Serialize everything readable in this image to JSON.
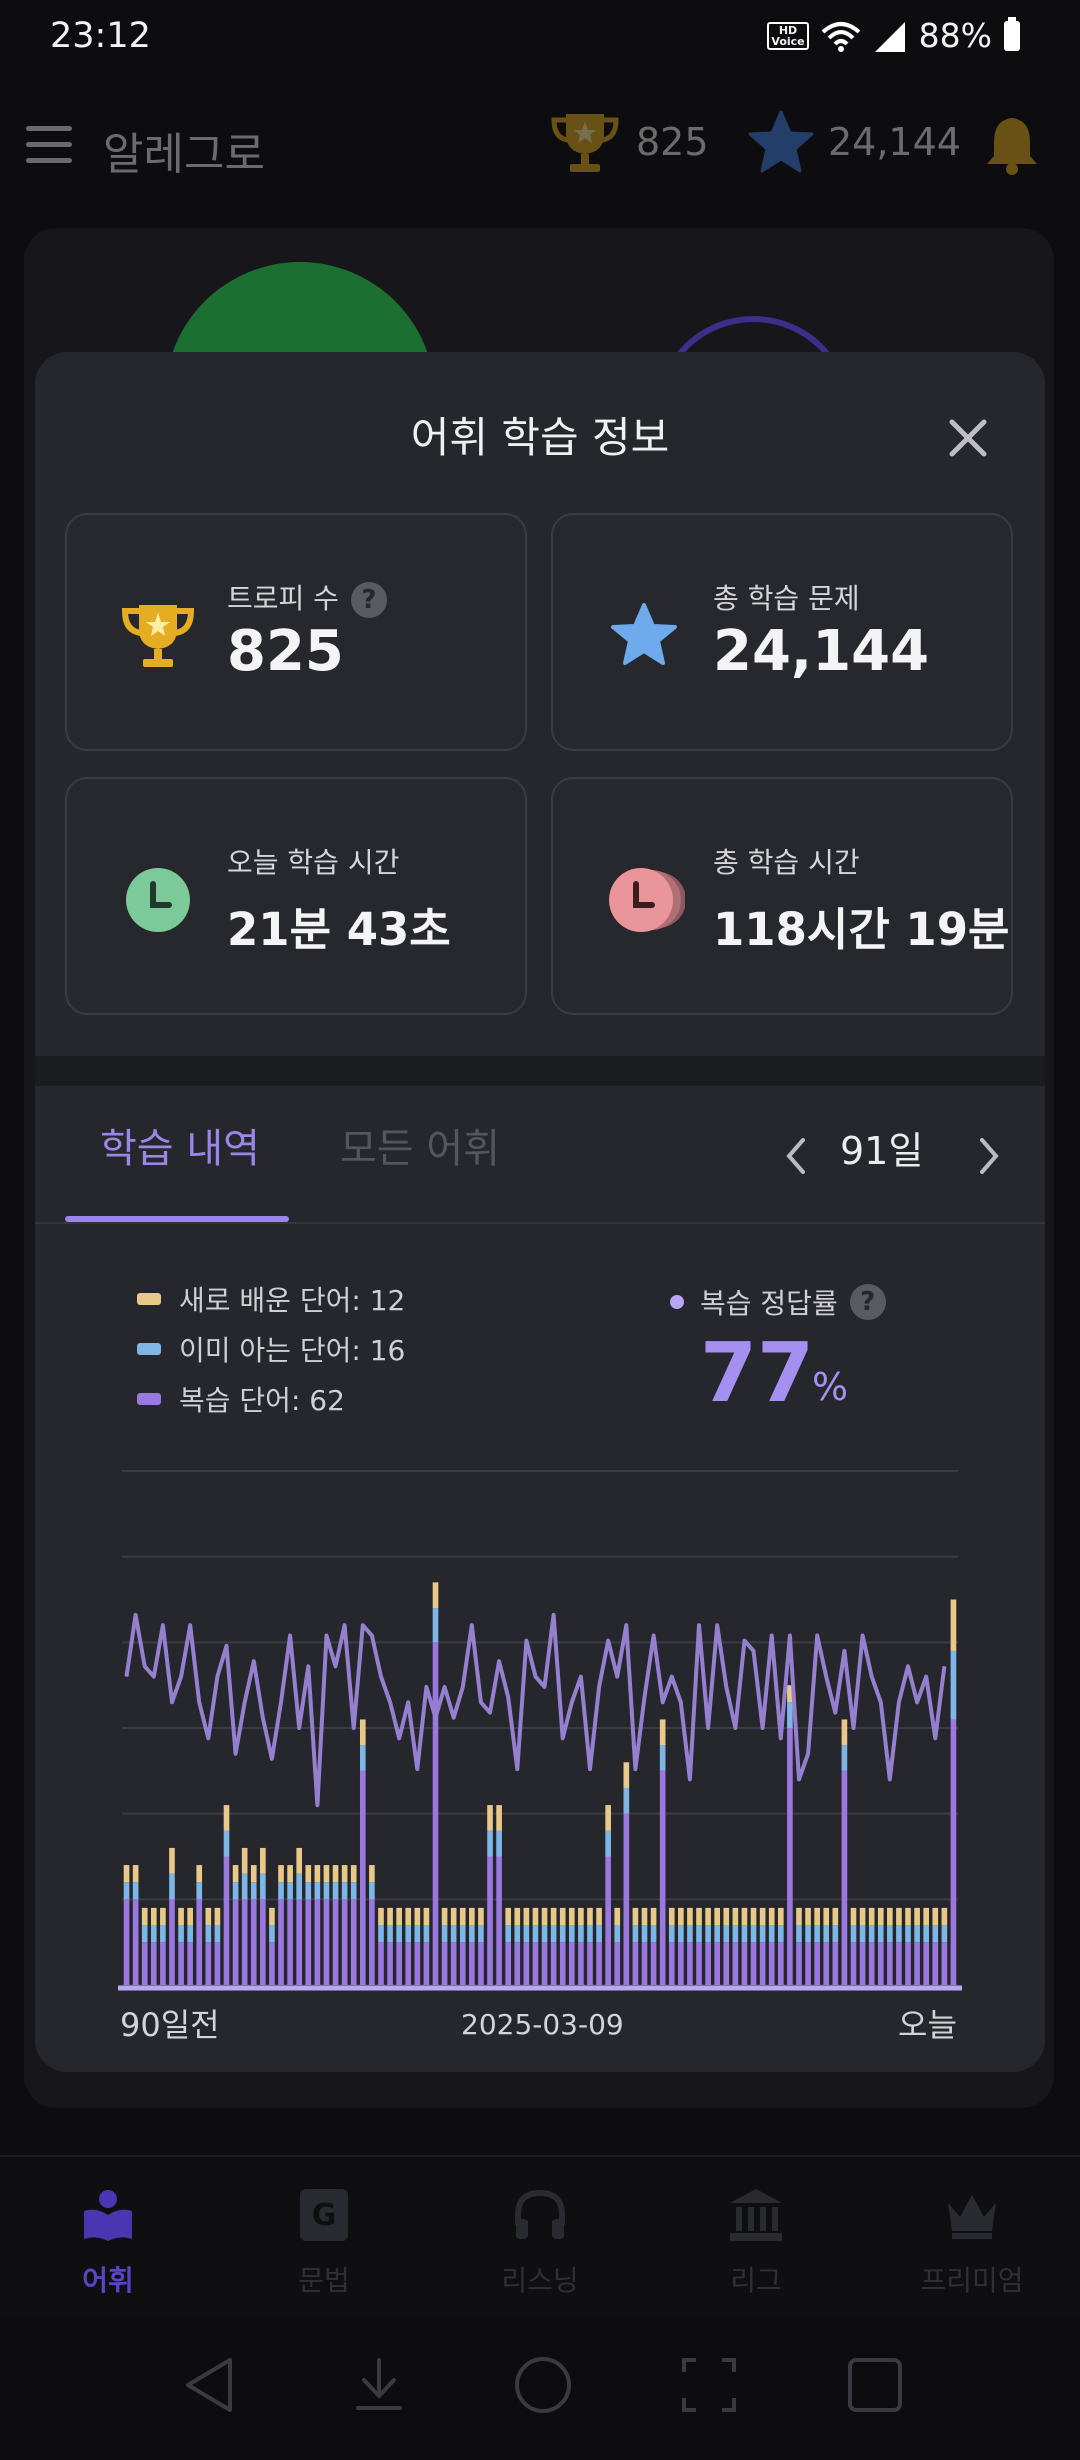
{
  "status_bar": {
    "time": "23:12",
    "battery": "88%"
  },
  "header": {
    "title": "알레그로",
    "trophy_count": "825",
    "star_count": "24,144"
  },
  "modal": {
    "title": "어휘 학습 정보",
    "stats": {
      "trophies": {
        "label": "트로피 수",
        "value": "825"
      },
      "total_questions": {
        "label": "총 학습 문제",
        "value": "24,144"
      },
      "today_time": {
        "label": "오늘 학습 시간",
        "value": "21분 43초"
      },
      "total_time": {
        "label": "총 학습 시간",
        "value": "118시간 19분"
      }
    },
    "tabs": [
      {
        "label": "학습 내역",
        "active": true
      },
      {
        "label": "모든 어휘",
        "active": false
      }
    ],
    "period": "91일",
    "legend": {
      "new_words": "새로 배운 단어: 12",
      "known_words": "이미 아는 단어: 16",
      "review_words": "복습 단어: 62"
    },
    "accuracy": {
      "label": "복습 정답률",
      "value": "77",
      "unit": "%"
    },
    "x_labels": {
      "start": "90일전",
      "mid": "2025-03-09",
      "end": "오늘"
    }
  },
  "colors": {
    "new": "#e8c98a",
    "known": "#7fb6e8",
    "review": "#9a78e0",
    "accuracy_line": "#9580d0",
    "accent": "#9b86e8"
  },
  "chart_data": {
    "type": "bar",
    "stacked": true,
    "days": 91,
    "series": [
      {
        "name": "새로 배운 단어",
        "values": [
          4,
          4,
          4,
          4,
          4,
          6,
          4,
          4,
          4,
          4,
          4,
          6,
          4,
          6,
          4,
          6,
          4,
          4,
          4,
          6,
          4,
          4,
          4,
          4,
          4,
          4,
          6,
          4,
          4,
          4,
          4,
          4,
          4,
          4,
          6,
          4,
          4,
          4,
          4,
          4,
          6,
          6,
          4,
          4,
          4,
          4,
          4,
          4,
          4,
          4,
          4,
          4,
          4,
          6,
          4,
          6,
          4,
          4,
          4,
          6,
          4,
          4,
          4,
          4,
          4,
          4,
          4,
          4,
          4,
          4,
          4,
          4,
          4,
          4,
          4,
          4,
          4,
          4,
          4,
          6,
          4,
          4,
          4,
          4,
          4,
          4,
          4,
          4,
          4,
          4,
          4,
          12
        ]
      },
      {
        "name": "이미 아는 단어",
        "values": [
          4,
          4,
          4,
          4,
          4,
          6,
          4,
          4,
          4,
          4,
          4,
          6,
          4,
          6,
          4,
          6,
          4,
          4,
          4,
          6,
          4,
          4,
          4,
          4,
          4,
          4,
          6,
          4,
          4,
          4,
          4,
          4,
          4,
          4,
          8,
          4,
          4,
          4,
          4,
          4,
          6,
          6,
          4,
          4,
          4,
          4,
          4,
          4,
          4,
          4,
          4,
          4,
          4,
          6,
          4,
          6,
          4,
          4,
          4,
          6,
          4,
          4,
          4,
          4,
          4,
          4,
          4,
          4,
          4,
          4,
          4,
          4,
          4,
          6,
          4,
          4,
          4,
          4,
          4,
          6,
          4,
          4,
          4,
          4,
          4,
          4,
          4,
          4,
          4,
          4,
          4,
          16
        ]
      },
      {
        "name": "복습 단어",
        "values": [
          20,
          20,
          10,
          10,
          10,
          20,
          10,
          10,
          20,
          10,
          10,
          30,
          20,
          20,
          20,
          20,
          10,
          20,
          20,
          20,
          20,
          20,
          20,
          20,
          20,
          20,
          50,
          20,
          10,
          10,
          10,
          10,
          10,
          10,
          80,
          10,
          10,
          10,
          10,
          10,
          30,
          30,
          10,
          10,
          10,
          10,
          10,
          10,
          10,
          10,
          10,
          10,
          10,
          30,
          10,
          40,
          10,
          10,
          10,
          50,
          10,
          10,
          10,
          10,
          10,
          10,
          10,
          10,
          10,
          10,
          10,
          10,
          10,
          60,
          10,
          10,
          10,
          10,
          10,
          50,
          10,
          10,
          10,
          10,
          10,
          10,
          10,
          10,
          10,
          10,
          10,
          62
        ]
      }
    ],
    "accuracy_series": {
      "name": "복습 정답률",
      "values": [
        60,
        72,
        62,
        60,
        70,
        55,
        60,
        70,
        55,
        48,
        60,
        66,
        45,
        55,
        63,
        52,
        44,
        55,
        68,
        50,
        62,
        35,
        68,
        62,
        70,
        50,
        70,
        68,
        60,
        55,
        48,
        55,
        42,
        58,
        52,
        58,
        52,
        58,
        70,
        55,
        53,
        63,
        56,
        42,
        67,
        60,
        58,
        72,
        48,
        55,
        60,
        42,
        58,
        67,
        60,
        70,
        42,
        56,
        68,
        55,
        60,
        55,
        40,
        70,
        50,
        70,
        58,
        50,
        67,
        65,
        50,
        68,
        48,
        68,
        40,
        45,
        68,
        60,
        53,
        65,
        50,
        68,
        60,
        55,
        40,
        55,
        62,
        55,
        60,
        48,
        62
      ]
    },
    "ylim": [
      0,
      120
    ]
  }
}
